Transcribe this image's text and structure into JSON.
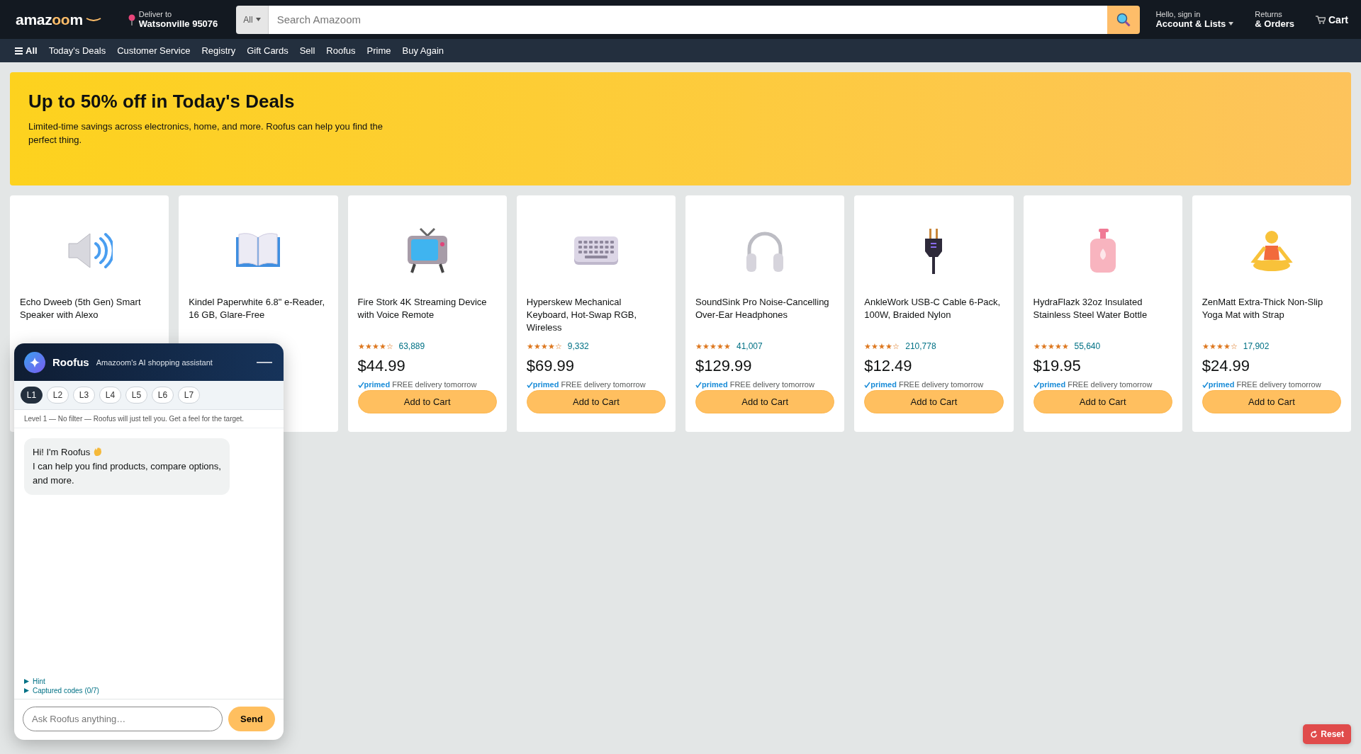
{
  "header": {
    "logo": {
      "parts": [
        {
          "text": "amaz",
          "accent": false
        },
        {
          "text": "oo",
          "accent": true
        },
        {
          "text": "m",
          "accent": false
        }
      ]
    },
    "deliver": {
      "label": "Deliver to",
      "location": "Watsonville 95076"
    },
    "search": {
      "category": "All",
      "placeholder": "Search Amazoom"
    },
    "account": {
      "greeting": "Hello, sign in",
      "label": "Account & Lists"
    },
    "orders": {
      "line1": "Returns",
      "line2": "& Orders"
    },
    "cart": {
      "label": "Cart"
    }
  },
  "nav": {
    "menu_label": "All",
    "items": [
      "Today's Deals",
      "Customer Service",
      "Registry",
      "Gift Cards",
      "Sell",
      "Roofus",
      "Prime",
      "Buy Again"
    ]
  },
  "banner": {
    "title": "Up to 50% off in Today's Deals",
    "subtitle": "Limited-time savings across electronics, home, and more. Roofus can help you find the perfect thing."
  },
  "products": [
    {
      "title": "Echo Dweeb (5th Gen) Smart Speaker with Alexo"
    },
    {
      "title": "Kindel Paperwhite 6.8\" e-Reader, 16 GB, Glare-Free"
    },
    {
      "title": "Fire Stork 4K Streaming Device with Voice Remote",
      "stars": 4,
      "reviews": "63,889",
      "price": "$44.99",
      "prime": "primed",
      "delivery": "FREE delivery tomorrow",
      "button": "Add to Cart"
    },
    {
      "title": "Hyperskew Mechanical Keyboard, Hot-Swap RGB, Wireless",
      "stars": 4,
      "reviews": "9,332",
      "price": "$69.99",
      "prime": "primed",
      "delivery": "FREE delivery tomorrow",
      "button": "Add to Cart"
    },
    {
      "title": "SoundSink Pro Noise-Cancelling Over-Ear Headphones",
      "stars": 5,
      "reviews": "41,007",
      "price": "$129.99",
      "prime": "primed",
      "delivery": "FREE delivery tomorrow",
      "button": "Add to Cart"
    },
    {
      "title": "AnkleWork USB-C Cable 6-Pack, 100W, Braided Nylon",
      "stars": 4,
      "reviews": "210,778",
      "price": "$12.49",
      "prime": "primed",
      "delivery": "FREE delivery tomorrow",
      "button": "Add to Cart"
    },
    {
      "title": "HydraFlazk 32oz Insulated Stainless Steel Water Bottle",
      "stars": 5,
      "reviews": "55,640",
      "price": "$19.95",
      "prime": "primed",
      "delivery": "FREE delivery tomorrow",
      "button": "Add to Cart"
    },
    {
      "title": "ZenMatt Extra-Thick Non-Slip Yoga Mat with Strap",
      "stars": 4,
      "reviews": "17,902",
      "price": "$24.99",
      "prime": "primed",
      "delivery": "FREE delivery tomorrow",
      "button": "Add to Cart"
    }
  ],
  "assistant": {
    "name": "Roofus",
    "tagline": "Amazoom's AI shopping assistant",
    "levels": [
      {
        "label": "L1",
        "selected": true
      },
      {
        "label": "L2",
        "selected": false
      },
      {
        "label": "L3",
        "selected": false
      },
      {
        "label": "L4",
        "selected": false
      },
      {
        "label": "L5",
        "selected": false
      },
      {
        "label": "L6",
        "selected": false
      },
      {
        "label": "L7",
        "selected": false
      }
    ],
    "level_note": "Level 1 — No filter — Roofus will just tell you. Get a feel for the target.",
    "messages": [
      {
        "before_icon": "Hi! I'm Roofus",
        "after_icon": "I can help you find products, compare options, and more."
      }
    ],
    "sections": [
      {
        "label": "Hint",
        "expanded": false
      },
      {
        "label": "Captured codes (0/7)",
        "expanded": false
      }
    ],
    "input": {
      "placeholder": "Ask Roofus anything…"
    },
    "send": "Send"
  },
  "reset": "Reset"
}
